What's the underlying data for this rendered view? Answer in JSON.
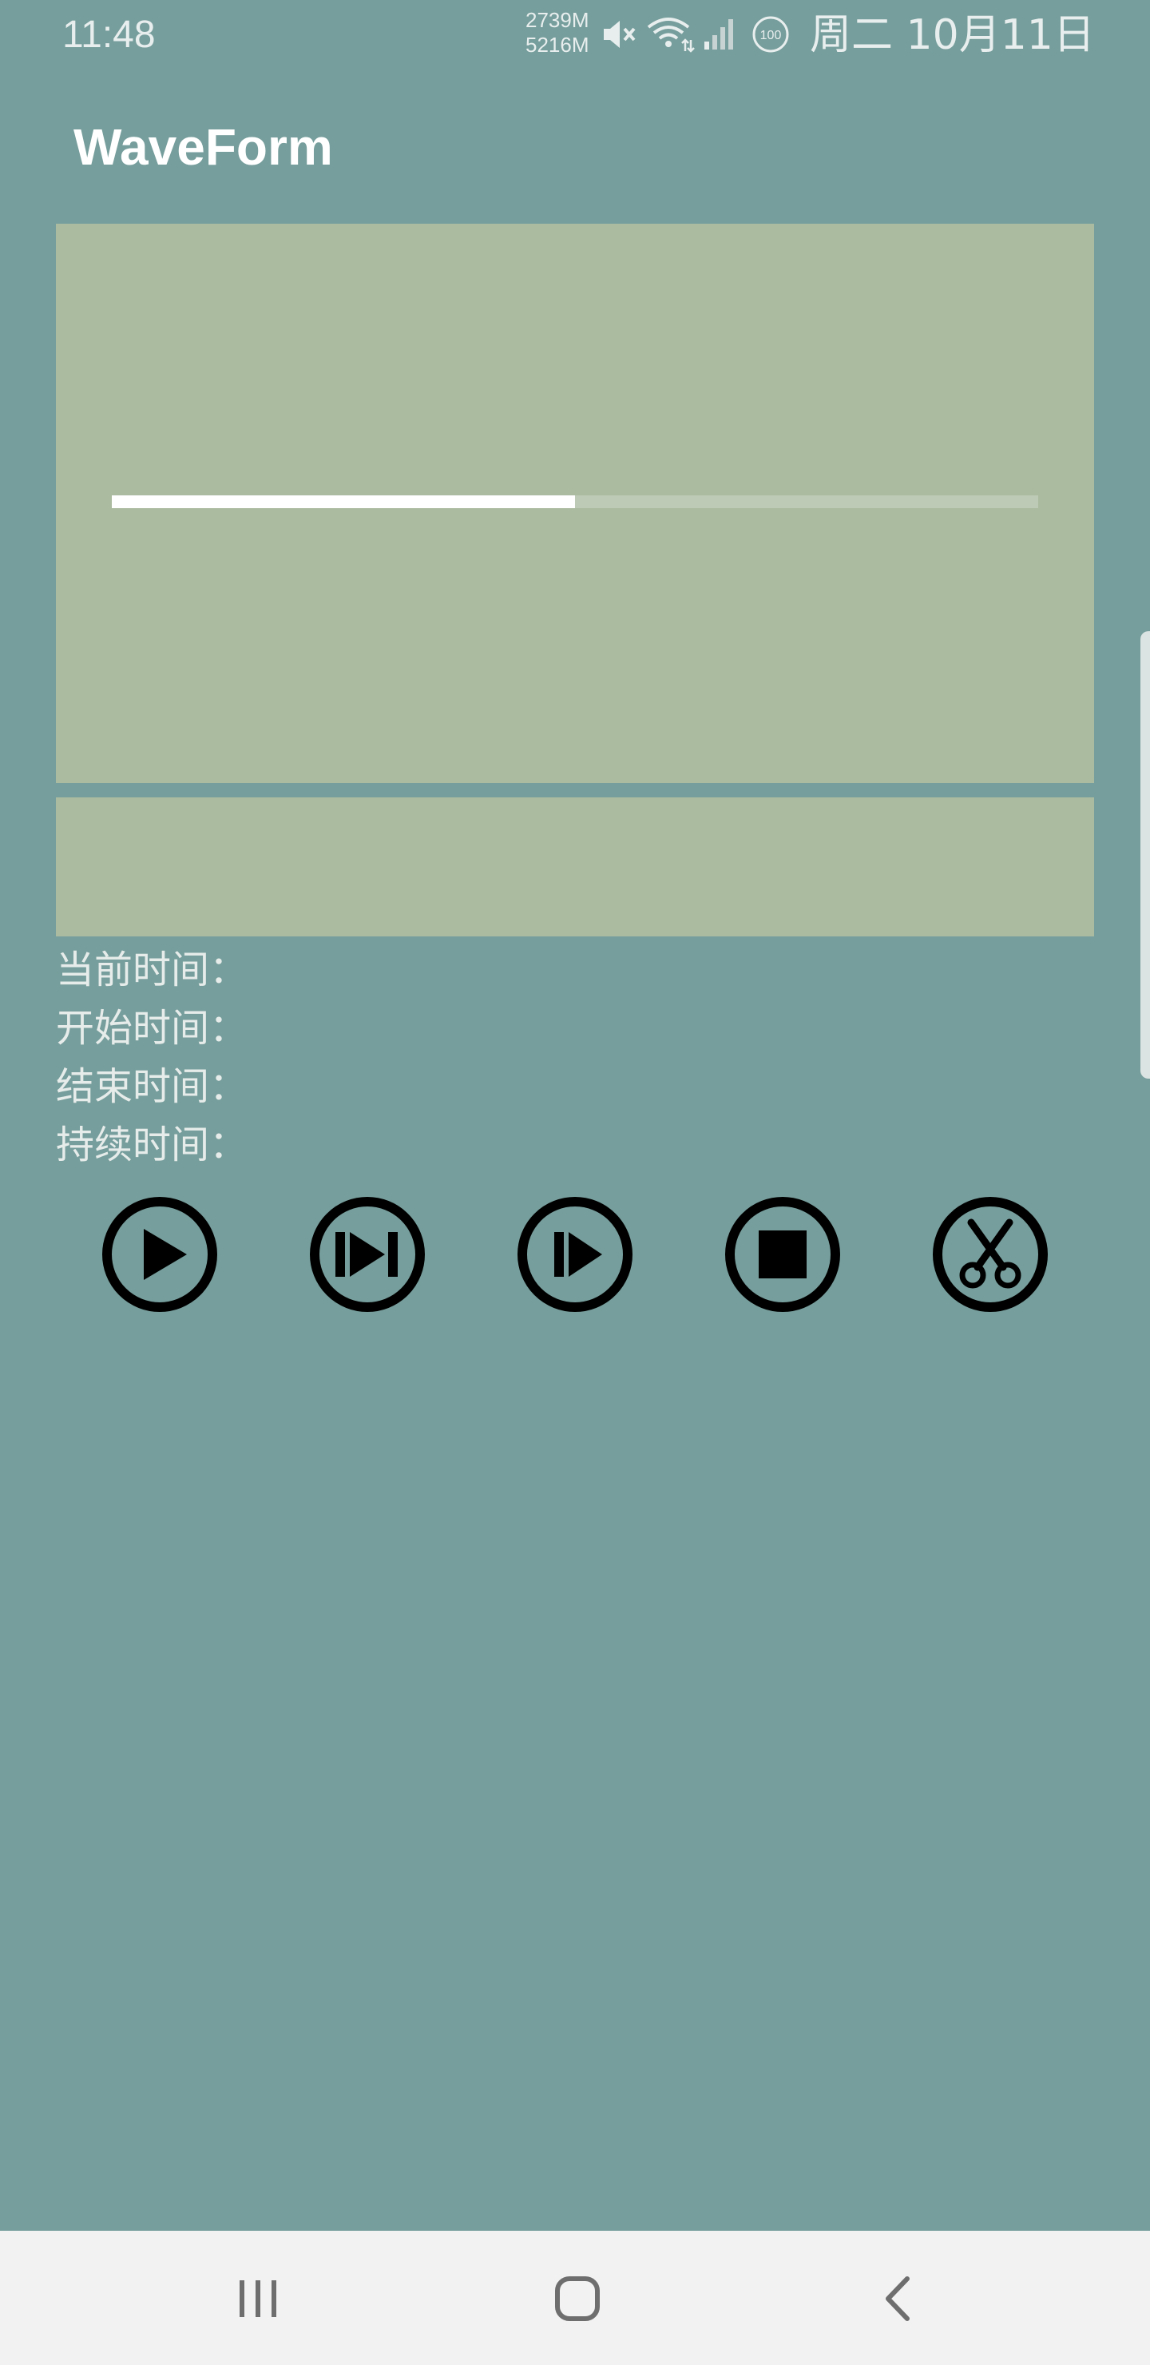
{
  "status_bar": {
    "time": "11:48",
    "memory_used": "2739M",
    "memory_free": "5216M",
    "battery": "100",
    "date": "周二 10月11日",
    "icons": [
      "mute-icon",
      "wifi-icon",
      "signal-icon",
      "battery-icon"
    ]
  },
  "app": {
    "title": "WaveForm"
  },
  "playback": {
    "progress": 0.5
  },
  "info": {
    "current_time_label": "当前时间：",
    "start_time_label": "开始时间：",
    "end_time_label": "结束时间：",
    "duration_label": "持续时间："
  },
  "controls": {
    "icons": [
      "play-icon",
      "skip-next-icon",
      "play-step-icon",
      "stop-icon",
      "scissors-icon"
    ]
  },
  "nav_bar": {
    "icons": [
      "recent-apps-icon",
      "home-icon",
      "back-icon"
    ]
  },
  "colors": {
    "background": "#769e9c",
    "panel": "#abbba0",
    "progress_fill": "#ffffff",
    "progress_track": "#bdcab5",
    "nav_bar": "#f2f2f2"
  }
}
